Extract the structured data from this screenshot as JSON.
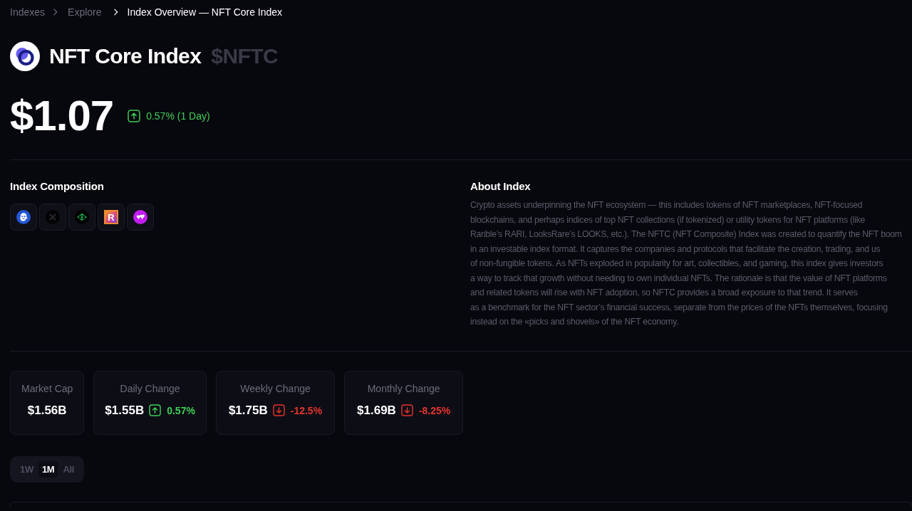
{
  "breadcrumb": [
    {
      "label": "Indexes",
      "current": false
    },
    {
      "label": "Explore",
      "current": false
    },
    {
      "label": "Index Overview — NFT Core Index",
      "current": true
    }
  ],
  "header": {
    "name": "NFT Core Index",
    "ticker": "$NFTC"
  },
  "price": {
    "value": "$1.07",
    "change": "0.57% (1 Day)",
    "up": true
  },
  "composition": {
    "title": "Index Composition",
    "tokens": [
      {
        "kind": "face"
      },
      {
        "kind": "cross"
      },
      {
        "kind": "eye"
      },
      {
        "kind": "letter",
        "letter": "R"
      },
      {
        "kind": "hearts"
      }
    ]
  },
  "about": {
    "title": "About Index",
    "lines": [
      "Crypto assets underpinning the NFT ecosystem — this includes tokens of NFT marketplaces, NFT-focused",
      "blockchains, and perhaps indices of top NFT collections (if tokenized) or utility tokens for NFT platforms (like",
      "Rarible’s RARI, LooksRare’s LOOKS, etc.). The NFTC (NFT Composite) Index was created to quantify the NFT boom",
      "in an investable index format. It captures the companies and protocols that facilitate the creation, trading, and us",
      "of non-fungible tokens. As NFTs exploded in popularity for art, collectibles, and gaming, this index gives investors",
      "a way to track that growth without needing to own individual NFTs. The rationale is that the value of NFT platforms",
      "and related tokens will rise with NFT adoption, so NFTC provides a broad exposure to that trend. It serves",
      "as a benchmark for the NFT sector’s financial success, separate from the prices of the NFTs themselves, focusing",
      "instead on the «picks and shovels» of the NFT economy."
    ]
  },
  "stats": [
    {
      "label": "Market Cap",
      "value": "$1.56B"
    },
    {
      "label": "Daily Change",
      "value": "$1.55B",
      "change": "0.57%",
      "up": true
    },
    {
      "label": "Weekly Change",
      "value": "$1.75B",
      "change": "-12.5%",
      "up": false
    },
    {
      "label": "Monthly Change",
      "value": "$1.69B",
      "change": "-8.25%",
      "up": false
    }
  ],
  "periods": [
    {
      "label": "1W",
      "selected": false
    },
    {
      "label": "1M",
      "selected": true
    },
    {
      "label": "All",
      "selected": false
    }
  ]
}
